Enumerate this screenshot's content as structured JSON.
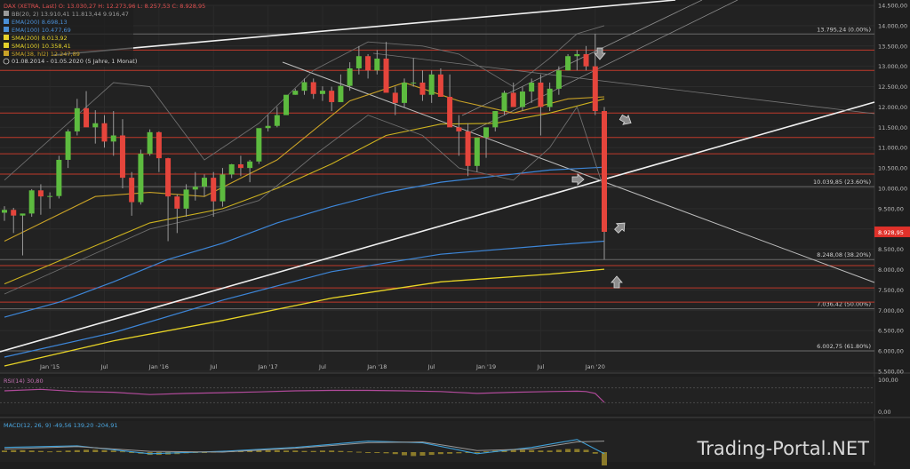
{
  "chart_data": {
    "type": "candlestick",
    "instrument": "DAX (XETRA, Last)",
    "ohlc_header": {
      "open": "O: 13.030,27",
      "high": "H: 12.273,96",
      "low": "L: 8.257,53",
      "close": "C: 8.928,95"
    },
    "period": "01.08.2014 - 01.05.2020",
    "timeframe": "(5 Jahre, 1 Monat)",
    "last_value_label": "8.928,95",
    "y_axis": {
      "min": 5500,
      "max": 14500,
      "scale": "linear",
      "tick_values": [
        5500,
        6000,
        6500,
        7000,
        7500,
        8000,
        8500,
        9000,
        9500,
        10000,
        10500,
        11000,
        11500,
        12000,
        12500,
        13000,
        13500,
        14000,
        14500
      ],
      "tick_labels": [
        "5.500,00",
        "6.000,00",
        "6.500,00",
        "7.000,00",
        "7.500,00",
        "8.000,00",
        "8.500,00",
        "9.000,00",
        "9.500,00",
        "10.000,00",
        "10.500,00",
        "11.000,00",
        "11.500,00",
        "12.000,00",
        "12.500,00",
        "13.000,00",
        "13.500,00",
        "14.000,00",
        "14.500,00"
      ]
    },
    "x_axis": {
      "labels": [
        "Jan '15",
        "Jul",
        "Jan '16",
        "Jul",
        "Jan '17",
        "Jul",
        "Jan '18",
        "Jul",
        "Jan '19",
        "Jul",
        "Jan '20"
      ],
      "label_months": [
        5,
        11,
        17,
        23,
        29,
        35,
        41,
        47,
        53,
        59,
        65
      ]
    },
    "legend": [
      {
        "label": "BB(20, 2)",
        "value": "13.910,41  11.813,44  9.916,47",
        "color": "#9a9a9a"
      },
      {
        "label": "EMA(200)",
        "value": "8.698,13",
        "color": "#4a8fd6"
      },
      {
        "label": "EMA(100)",
        "value": "10.477,69",
        "color": "#4a8fd6"
      },
      {
        "label": "SMA(200)",
        "value": "8.013,92",
        "color": "#e6d22a"
      },
      {
        "label": "SMA(100)",
        "value": "10.358,41",
        "color": "#e6d22a"
      },
      {
        "label": "SMA(38, hl2)",
        "value": "12.247,89",
        "color": "#c9a227"
      }
    ],
    "fib_levels": [
      {
        "value": 13795.24,
        "label": "13.795,24 (0.00%)"
      },
      {
        "value": 10039.85,
        "label": "10.039,85 (23.60%)"
      },
      {
        "value": 8248.08,
        "label": "8.248,08 (38.20%)"
      },
      {
        "value": 7036.42,
        "label": "7.036,42 (50.00%)"
      },
      {
        "value": 6002.75,
        "label": "6.002,75 (61.80%)"
      }
    ],
    "red_horizontals": [
      13400,
      12900,
      11850,
      11250,
      10850,
      10350,
      8100,
      7550,
      7200
    ],
    "candles": [
      [
        9400,
        9560,
        9200,
        9470
      ],
      [
        9470,
        9520,
        8900,
        9330
      ],
      [
        9330,
        9350,
        8350,
        9380
      ],
      [
        9380,
        9980,
        9300,
        9950
      ],
      [
        9950,
        10100,
        9350,
        9800
      ],
      [
        9800,
        9900,
        9500,
        9810
      ],
      [
        9810,
        10800,
        9750,
        10700
      ],
      [
        10700,
        11450,
        10500,
        11400
      ],
      [
        11400,
        12200,
        11300,
        11970
      ],
      [
        11970,
        12390,
        11800,
        11500
      ],
      [
        11500,
        11920,
        11100,
        11600
      ],
      [
        11600,
        11800,
        11000,
        11150
      ],
      [
        11150,
        11900,
        10800,
        11300
      ],
      [
        11300,
        11700,
        10000,
        10260
      ],
      [
        10260,
        10400,
        9325,
        9660
      ],
      [
        9660,
        10950,
        9600,
        10850
      ],
      [
        10850,
        11450,
        10800,
        11380
      ],
      [
        11380,
        11400,
        10400,
        10740
      ],
      [
        10740,
        10750,
        8700,
        9800
      ],
      [
        9800,
        9850,
        8900,
        9500
      ],
      [
        9500,
        10100,
        9300,
        9970
      ],
      [
        9970,
        10400,
        9700,
        10040
      ],
      [
        10040,
        10340,
        9800,
        10260
      ],
      [
        10260,
        10400,
        9300,
        9680
      ],
      [
        9680,
        10500,
        9550,
        10340
      ],
      [
        10340,
        10600,
        10250,
        10590
      ],
      [
        10590,
        10800,
        10300,
        10500
      ],
      [
        10500,
        10700,
        10150,
        10660
      ],
      [
        10660,
        11350,
        10600,
        11480
      ],
      [
        11480,
        11800,
        11400,
        11535
      ],
      [
        11535,
        12000,
        11500,
        11800
      ],
      [
        11800,
        12100,
        11900,
        12300
      ],
      [
        12300,
        12450,
        12300,
        12400
      ],
      [
        12400,
        12700,
        12300,
        12610
      ],
      [
        12610,
        12700,
        12200,
        12320
      ],
      [
        12320,
        12510,
        12150,
        12400
      ],
      [
        12400,
        12500,
        11900,
        12120
      ],
      [
        12120,
        12800,
        12200,
        12520
      ],
      [
        12520,
        13100,
        12400,
        12950
      ],
      [
        12950,
        13500,
        12800,
        13250
      ],
      [
        13250,
        13300,
        12700,
        12900
      ],
      [
        12900,
        13400,
        12800,
        13190
      ],
      [
        13190,
        13600,
        12800,
        12350
      ],
      [
        12350,
        12500,
        11800,
        12100
      ],
      [
        12100,
        12700,
        12000,
        12600
      ],
      [
        12600,
        13200,
        12500,
        12600
      ],
      [
        12600,
        12900,
        12150,
        12300
      ],
      [
        12300,
        12900,
        12100,
        12800
      ],
      [
        12800,
        12950,
        12300,
        12250
      ],
      [
        12250,
        12800,
        11800,
        11500
      ],
      [
        11500,
        11800,
        10800,
        11400
      ],
      [
        11400,
        11600,
        10300,
        10550
      ],
      [
        10550,
        11200,
        10400,
        11250
      ],
      [
        11250,
        11400,
        10750,
        11500
      ],
      [
        11500,
        11900,
        11400,
        11900
      ],
      [
        11900,
        12400,
        11800,
        12350
      ],
      [
        12350,
        12600,
        12000,
        12000
      ],
      [
        12000,
        12500,
        11900,
        12380
      ],
      [
        12380,
        12700,
        12100,
        12600
      ],
      [
        12600,
        12800,
        11300,
        12000
      ],
      [
        12000,
        12600,
        11900,
        12450
      ],
      [
        12450,
        13000,
        12300,
        12900
      ],
      [
        12900,
        13300,
        12900,
        13250
      ],
      [
        13250,
        13400,
        12900,
        13300
      ],
      [
        13300,
        13500,
        12900,
        13000
      ],
      [
        13000,
        13800,
        11800,
        11900
      ],
      [
        11900,
        12000,
        8250,
        8930
      ]
    ],
    "series": [
      {
        "name": "EMA(100)",
        "points": [
          [
            0,
            6830
          ],
          [
            6,
            7200
          ],
          [
            12,
            7700
          ],
          [
            18,
            8250
          ],
          [
            24,
            8650
          ],
          [
            30,
            9150
          ],
          [
            36,
            9550
          ],
          [
            42,
            9900
          ],
          [
            48,
            10150
          ],
          [
            54,
            10300
          ],
          [
            60,
            10450
          ],
          [
            66,
            10520
          ]
        ]
      },
      {
        "name": "EMA(200)",
        "points": [
          [
            0,
            5850
          ],
          [
            12,
            6450
          ],
          [
            24,
            7250
          ],
          [
            36,
            7950
          ],
          [
            48,
            8380
          ],
          [
            60,
            8600
          ],
          [
            66,
            8700
          ]
        ]
      },
      {
        "name": "SMA(200)",
        "points": [
          [
            0,
            5630
          ],
          [
            12,
            6250
          ],
          [
            24,
            6750
          ],
          [
            36,
            7300
          ],
          [
            48,
            7700
          ],
          [
            60,
            7890
          ],
          [
            66,
            8010
          ]
        ]
      },
      {
        "name": "SMA(100)",
        "points": [
          [
            0,
            7650
          ],
          [
            8,
            8400
          ],
          [
            16,
            9150
          ],
          [
            24,
            9500
          ],
          [
            30,
            10000
          ],
          [
            36,
            10600
          ],
          [
            42,
            11300
          ],
          [
            48,
            11580
          ],
          [
            54,
            11600
          ],
          [
            60,
            11850
          ],
          [
            66,
            12200
          ]
        ]
      },
      {
        "name": "SMA(38, hl2)",
        "points": [
          [
            0,
            8700
          ],
          [
            10,
            9800
          ],
          [
            16,
            9900
          ],
          [
            22,
            9800
          ],
          [
            30,
            10700
          ],
          [
            38,
            12150
          ],
          [
            44,
            12600
          ],
          [
            50,
            12150
          ],
          [
            56,
            11850
          ],
          [
            62,
            12200
          ],
          [
            66,
            12250
          ]
        ]
      },
      {
        "name": "BB upper",
        "points": [
          [
            0,
            10200
          ],
          [
            12,
            12600
          ],
          [
            16,
            12500
          ],
          [
            22,
            10700
          ],
          [
            28,
            11600
          ],
          [
            34,
            12900
          ],
          [
            40,
            13600
          ],
          [
            46,
            13500
          ],
          [
            50,
            13300
          ],
          [
            56,
            12500
          ],
          [
            60,
            13200
          ],
          [
            63,
            13800
          ],
          [
            66,
            14000
          ]
        ]
      },
      {
        "name": "BB lower",
        "points": [
          [
            0,
            7400
          ],
          [
            12,
            8600
          ],
          [
            16,
            9000
          ],
          [
            22,
            9300
          ],
          [
            28,
            9700
          ],
          [
            34,
            10800
          ],
          [
            40,
            11800
          ],
          [
            46,
            11300
          ],
          [
            50,
            10500
          ],
          [
            56,
            10200
          ],
          [
            60,
            11000
          ],
          [
            63,
            12000
          ],
          [
            66,
            9950
          ]
        ]
      }
    ],
    "rsi": {
      "label": "RSI(14)",
      "value": "30,80",
      "tick_labels": [
        "100,00",
        "0,00"
      ],
      "levels": [
        70,
        30
      ],
      "points": [
        [
          0,
          62
        ],
        [
          4,
          66
        ],
        [
          8,
          60
        ],
        [
          12,
          58
        ],
        [
          16,
          52
        ],
        [
          20,
          55
        ],
        [
          24,
          57
        ],
        [
          28,
          59
        ],
        [
          32,
          62
        ],
        [
          36,
          63
        ],
        [
          40,
          63
        ],
        [
          44,
          62
        ],
        [
          48,
          60
        ],
        [
          52,
          55
        ],
        [
          56,
          58
        ],
        [
          60,
          60
        ],
        [
          63,
          61
        ],
        [
          64,
          60
        ],
        [
          65,
          55
        ],
        [
          66,
          31
        ]
      ]
    },
    "macd": {
      "label": "MACD(12, 26, 9)",
      "values": "-49,56  139,20  -204,91",
      "macd_points": [
        [
          0,
          60
        ],
        [
          8,
          80
        ],
        [
          16,
          -20
        ],
        [
          24,
          10
        ],
        [
          32,
          60
        ],
        [
          40,
          140
        ],
        [
          46,
          120
        ],
        [
          52,
          -20
        ],
        [
          58,
          60
        ],
        [
          63,
          160
        ],
        [
          66,
          -20
        ]
      ],
      "signal_points": [
        [
          0,
          40
        ],
        [
          8,
          70
        ],
        [
          16,
          10
        ],
        [
          24,
          0
        ],
        [
          32,
          50
        ],
        [
          40,
          120
        ],
        [
          46,
          130
        ],
        [
          52,
          20
        ],
        [
          58,
          40
        ],
        [
          63,
          130
        ],
        [
          66,
          140
        ]
      ],
      "histogram": [
        20,
        25,
        25,
        20,
        15,
        10,
        15,
        20,
        25,
        30,
        30,
        25,
        20,
        10,
        -5,
        -20,
        -35,
        -35,
        -30,
        -25,
        -15,
        -10,
        -5,
        5,
        10,
        15,
        20,
        25,
        25,
        25,
        25,
        20,
        20,
        15,
        15,
        20,
        20,
        15,
        10,
        5,
        0,
        -5,
        -15,
        -25,
        -40,
        -50,
        -45,
        -35,
        -25,
        -20,
        -15,
        -10,
        0,
        10,
        20,
        25,
        30,
        30,
        25,
        20,
        20,
        30,
        40,
        40,
        30,
        -20,
        -200
      ],
      "min": -260,
      "max": 260
    },
    "watermark": "Trading-Portal.NET"
  }
}
